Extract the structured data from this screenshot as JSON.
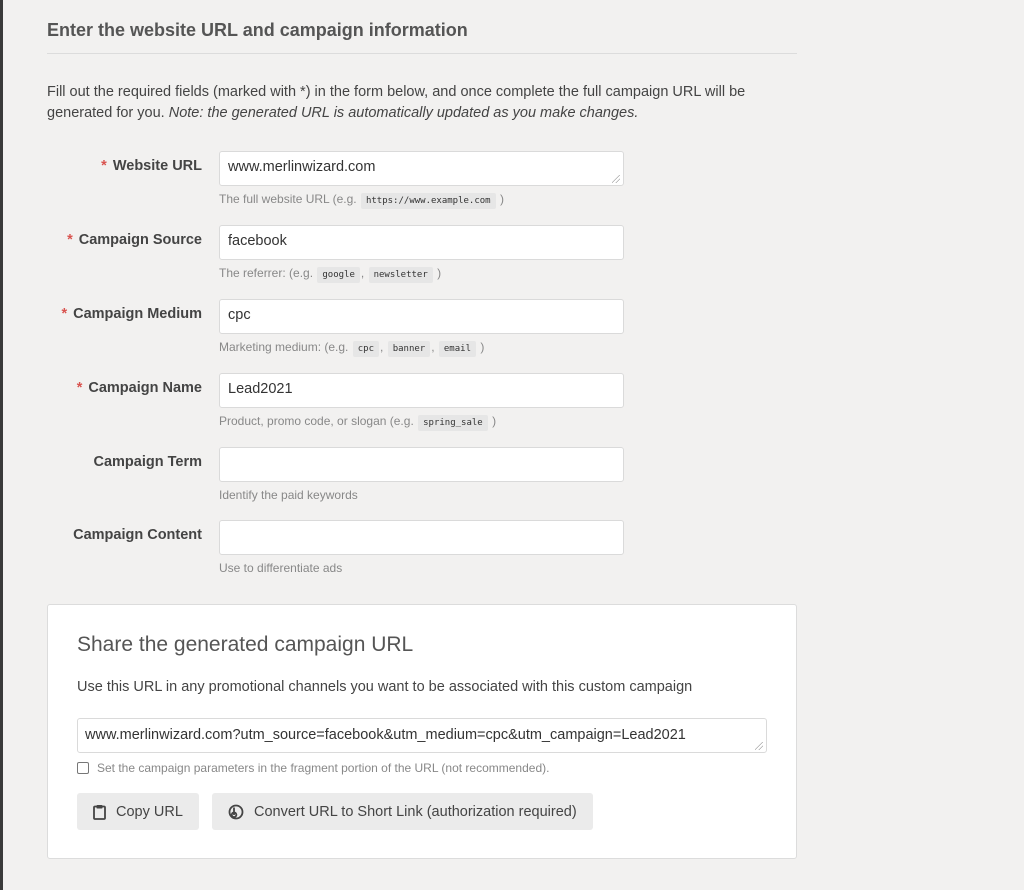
{
  "section": {
    "title": "Enter the website URL and campaign information",
    "intro_text": "Fill out the required fields (marked with *) in the form below, and once complete the full campaign URL will be generated for you.",
    "intro_note": "Note: the generated URL is automatically updated as you make changes."
  },
  "fields": [
    {
      "label": "Website URL",
      "required": true,
      "value": "www.merlinwizard.com",
      "help_prefix": "The full website URL (e.g.",
      "examples": [
        "https://www.example.com"
      ],
      "help_suffix": ")"
    },
    {
      "label": "Campaign Source",
      "required": true,
      "value": "facebook",
      "help_prefix": "The referrer: (e.g.",
      "examples": [
        "google",
        "newsletter"
      ],
      "help_suffix": ")"
    },
    {
      "label": "Campaign Medium",
      "required": true,
      "value": "cpc",
      "help_prefix": "Marketing medium: (e.g.",
      "examples": [
        "cpc",
        "banner",
        "email"
      ],
      "help_suffix": ")"
    },
    {
      "label": "Campaign Name",
      "required": true,
      "value": "Lead2021",
      "help_prefix": "Product, promo code, or slogan (e.g.",
      "examples": [
        "spring_sale"
      ],
      "help_suffix": ")"
    },
    {
      "label": "Campaign Term",
      "required": false,
      "value": "",
      "help_prefix": "Identify the paid keywords",
      "examples": [],
      "help_suffix": ""
    },
    {
      "label": "Campaign Content",
      "required": false,
      "value": "",
      "help_prefix": "Use to differentiate ads",
      "examples": [],
      "help_suffix": ""
    }
  ],
  "required_marker": "*",
  "share": {
    "title": "Share the generated campaign URL",
    "description": "Use this URL in any promotional channels you want to be associated with this custom campaign",
    "generated_url": "www.merlinwizard.com?utm_source=facebook&utm_medium=cpc&utm_campaign=Lead2021",
    "fragment_checkbox_label": "Set the campaign parameters in the fragment portion of the URL (not recommended).",
    "fragment_checked": false,
    "copy_button": {
      "label": "Copy URL",
      "icon": "clipboard-icon"
    },
    "short_link_button": {
      "label": "Convert URL to Short Link (authorization required)",
      "icon": "bitly-icon"
    }
  },
  "colors": {
    "required": "#d9534f",
    "background": "#f2f1f0",
    "button": "#ebebeb"
  }
}
